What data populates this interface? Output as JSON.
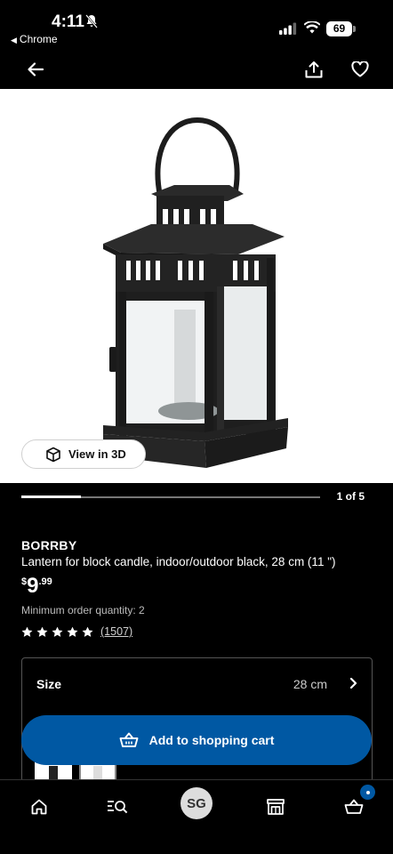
{
  "status_bar": {
    "time": "4:11",
    "back_app": "Chrome",
    "battery": "69"
  },
  "product": {
    "brand": "BORRBY",
    "description": "Lantern for block candle, indoor/outdoor black, 28 cm (11 \")",
    "price": {
      "currency": "$",
      "integer": "9",
      "decimal": ".99"
    },
    "min_order": "Minimum order quantity: 2",
    "rating": {
      "stars": 5,
      "count_label": "(1507)"
    }
  },
  "gallery": {
    "view_3d_label": "View in 3D",
    "counter": "1 of 5",
    "current": 1,
    "total": 5
  },
  "size": {
    "label": "Size",
    "value": "28 cm"
  },
  "cart_button": {
    "label": "Add to shopping cart"
  },
  "nav": {
    "items": [
      "home-icon",
      "search-list-icon",
      "avatar",
      "store-icon",
      "cart-icon"
    ],
    "avatar_initials": "SG"
  },
  "colors": {
    "background": "#000000",
    "accent": "#0058a3",
    "hero_background": "#ffffff"
  }
}
